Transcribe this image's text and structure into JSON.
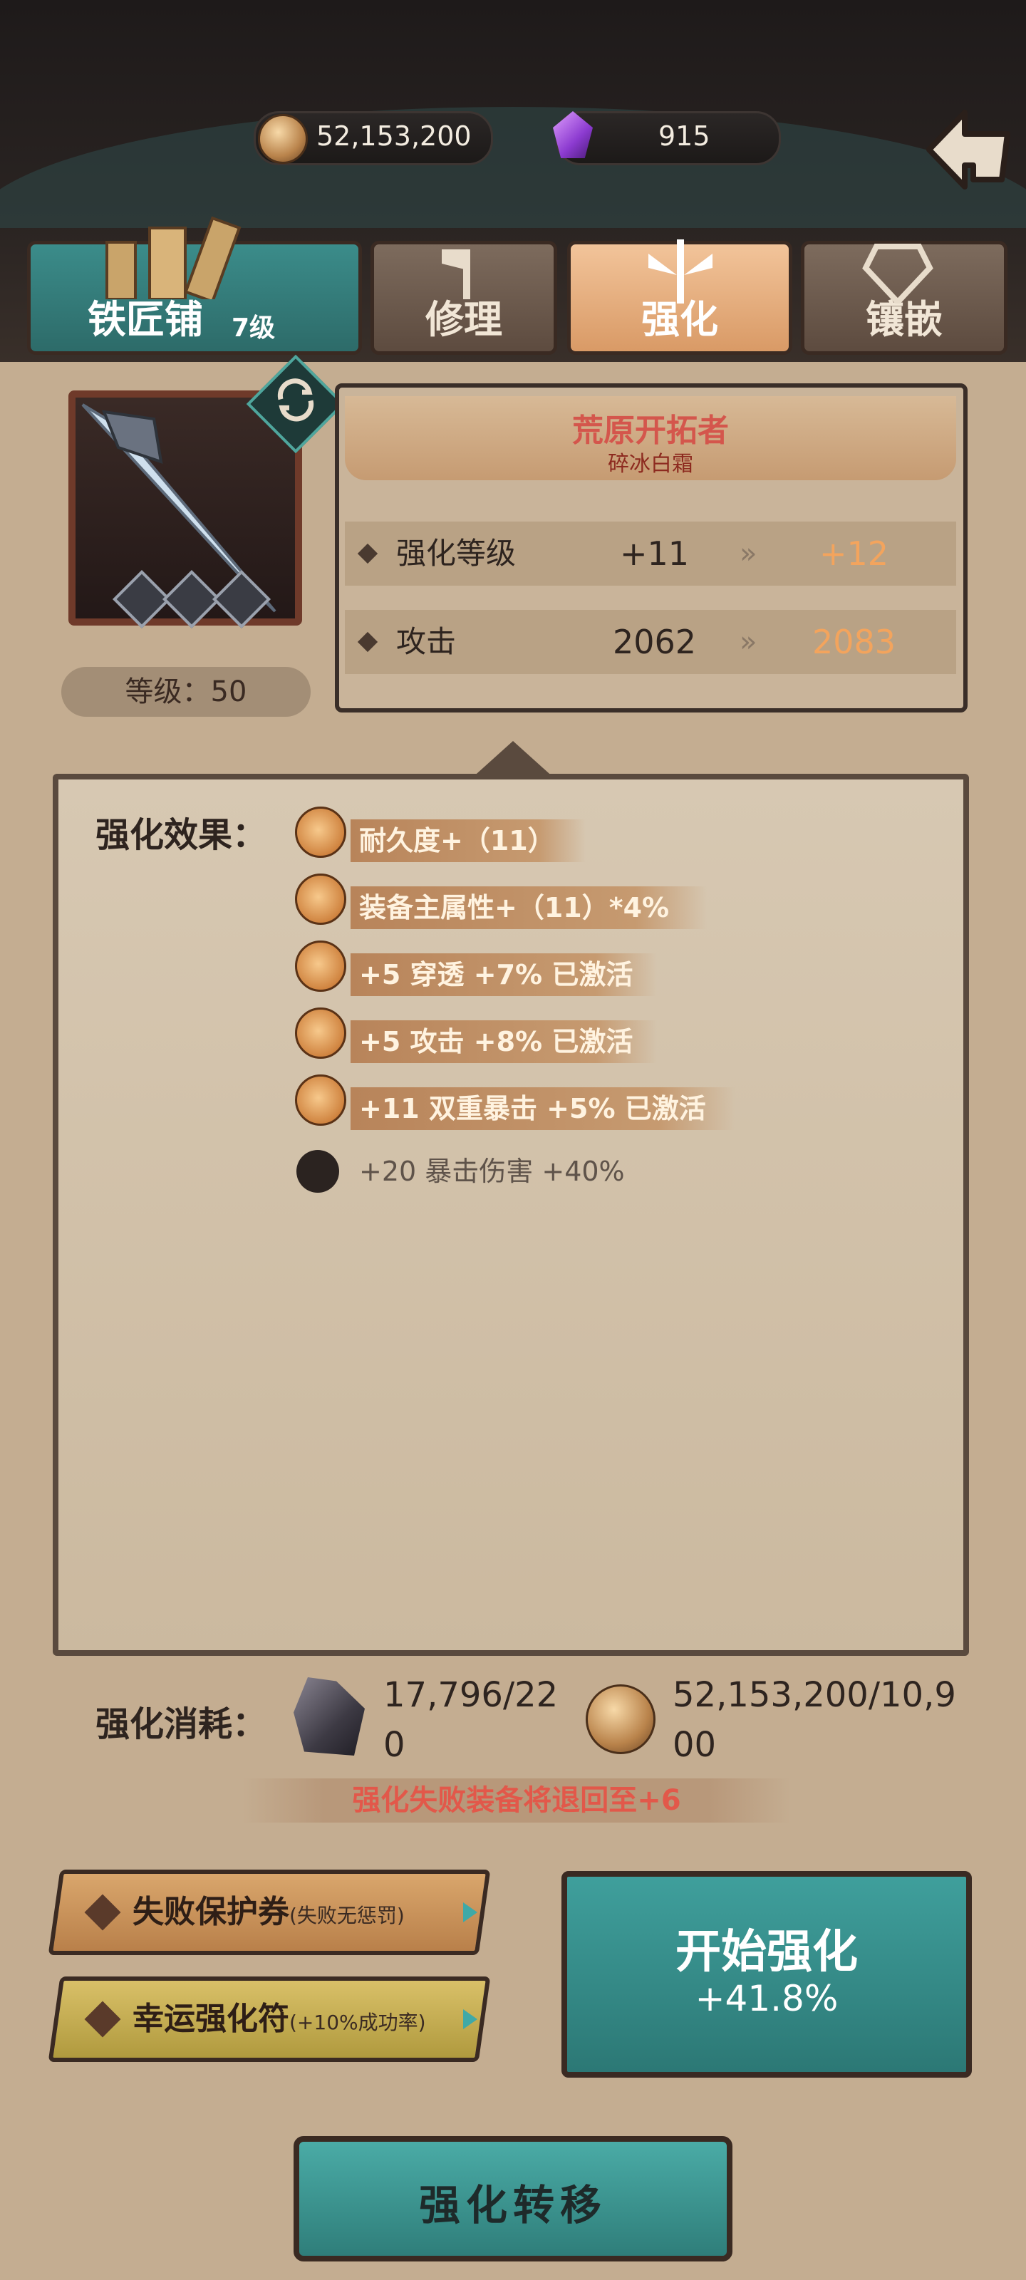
{
  "currencies": {
    "gold": {
      "value": "52,153,200",
      "icon": "coin-icon"
    },
    "gem": {
      "value": "915",
      "icon": "purple-gem-icon"
    }
  },
  "tabs": {
    "shop": {
      "name": "铁匠铺",
      "level": "7级"
    },
    "repair": {
      "label": "修理"
    },
    "enhance": {
      "label": "强化"
    },
    "inlay": {
      "label": "镶嵌"
    }
  },
  "item": {
    "name": "荒原开拓者",
    "subname": "碎冰白霜",
    "level": "等级：50",
    "icon": "ice-sword-icon",
    "sockets": 3
  },
  "stats": [
    {
      "label": "强化等级",
      "current": "+11",
      "next": "+12"
    },
    {
      "label": "攻击",
      "current": "2062",
      "next": "2083"
    }
  ],
  "effects": {
    "title": "强化效果：",
    "active": [
      "耐久度+（11）",
      "装备主属性+（11）*4%",
      "+5  穿透 +7% 已激活",
      "+5  攻击 +8% 已激活",
      "+11  双重暴击 +5% 已激活"
    ],
    "inactive": "+20  暴击伤害 +40%"
  },
  "cost": {
    "title": "强化消耗：",
    "ore": "17,796/220",
    "gold": "52,153,200/10,900",
    "warning": "强化失败装备将退回至+6"
  },
  "options": {
    "protect": {
      "label": "失败保护券",
      "note": "(失败无惩罚)"
    },
    "lucky": {
      "label": "幸运强化符",
      "note": "(+10%成功率)"
    }
  },
  "start": {
    "label": "开始强化",
    "rate": "+41.8%"
  },
  "transfer": {
    "label": "强化转移"
  },
  "colors": {
    "accent_teal": "#3f9f9c",
    "highlight_orange": "#f3a45d",
    "warning_red": "#e2584a",
    "item_name_red": "#d4564c"
  }
}
